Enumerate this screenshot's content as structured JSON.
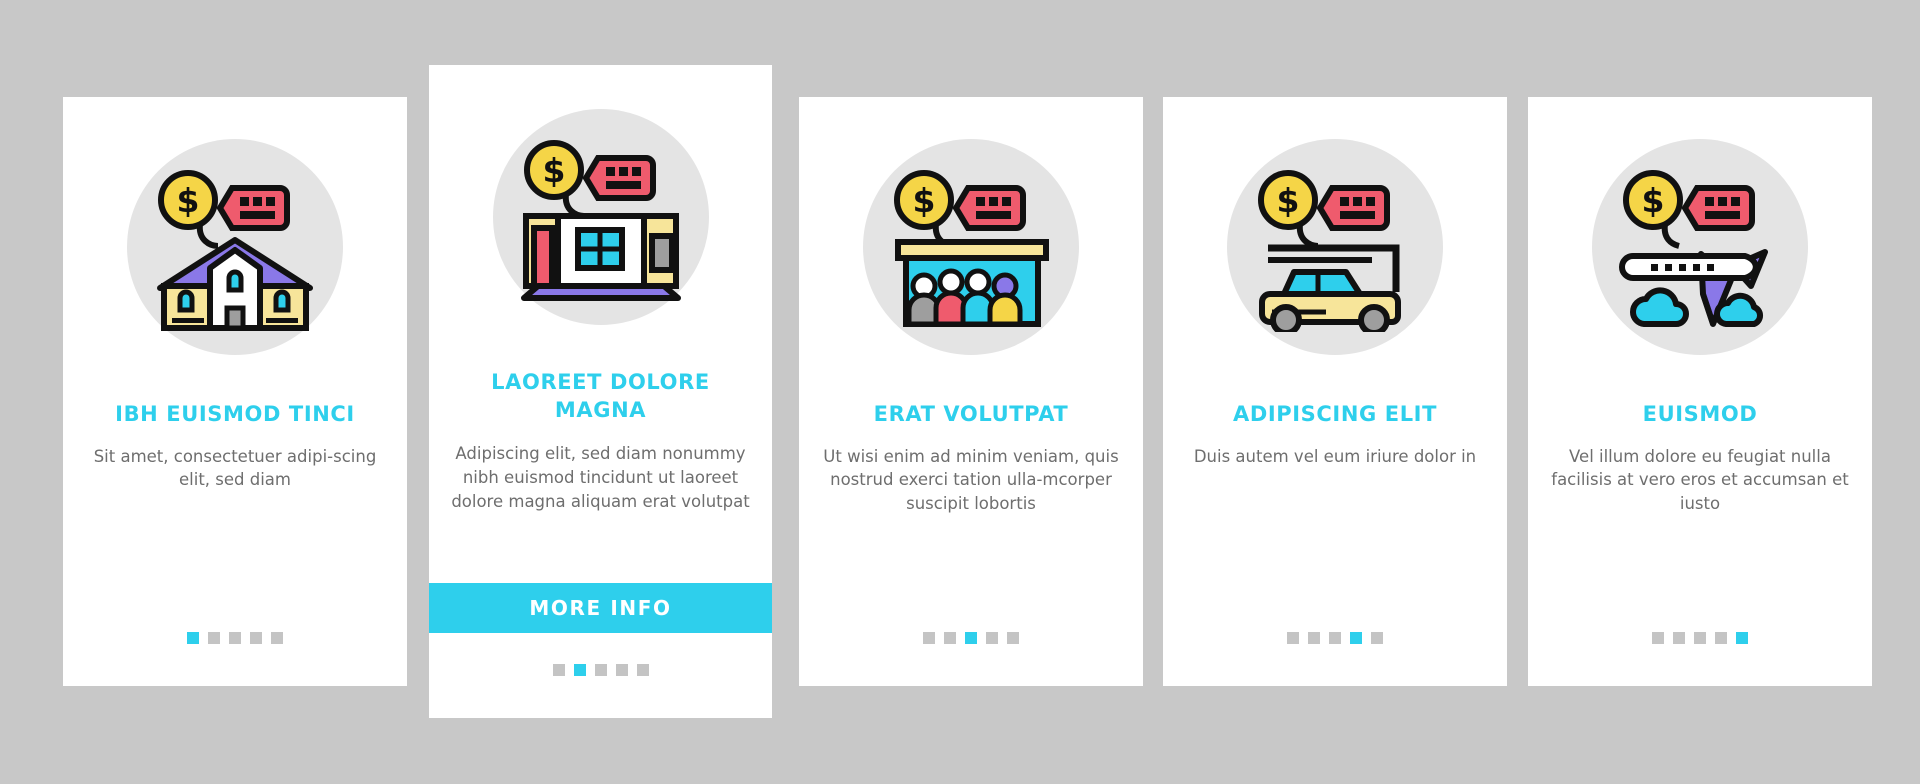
{
  "background_color": "#c8c8c8",
  "theme": {
    "accent": "#2ecfec",
    "card_bg": "#ffffff",
    "medallion_bg": "#e4e4e4",
    "body_text": "#6e6e6e",
    "dot_inactive": "#c4c4c4",
    "coin_yellow": "#f5d547",
    "tag_red": "#ef5b6d",
    "roof_purple": "#8a78e8",
    "wall_yellow": "#f7e59a",
    "window_cyan": "#2ecfec",
    "shade_gray": "#9e9e9e"
  },
  "screens": [
    {
      "id": "screen-1",
      "icon": "house-price-icon",
      "title": "IBH EUISMOD TINCI",
      "body": "Sit amet, consectetuer adipi-scing elit, sed diam",
      "dots": {
        "count": 5,
        "active_index": 0
      },
      "featured": false
    },
    {
      "id": "screen-2",
      "icon": "apartment-interior-price-icon",
      "title": "LAOREET DOLORE MAGNA",
      "body": "Adipiscing elit, sed diam nonummy nibh euismod tincidunt ut laoreet dolore magna aliquam erat volutpat",
      "dots": {
        "count": 5,
        "active_index": 1
      },
      "featured": true,
      "cta_label": "More Info"
    },
    {
      "id": "screen-3",
      "icon": "storefront-crowd-price-icon",
      "title": "ERAT VOLUTPAT",
      "body": "Ut wisi enim ad minim veniam, quis nostrud exerci tation ulla-mcorper suscipit lobortis",
      "dots": {
        "count": 5,
        "active_index": 2
      },
      "featured": false
    },
    {
      "id": "screen-4",
      "icon": "car-price-icon",
      "title": "ADIPISCING ELIT",
      "body": "Duis autem vel eum iriure dolor in",
      "dots": {
        "count": 5,
        "active_index": 3
      },
      "featured": false
    },
    {
      "id": "screen-5",
      "icon": "airplane-price-icon",
      "title": "EUISMOD",
      "body": "Vel illum dolore eu feugiat nulla facilisis at vero eros et accumsan et iusto",
      "dots": {
        "count": 5,
        "active_index": 4
      },
      "featured": false
    }
  ]
}
